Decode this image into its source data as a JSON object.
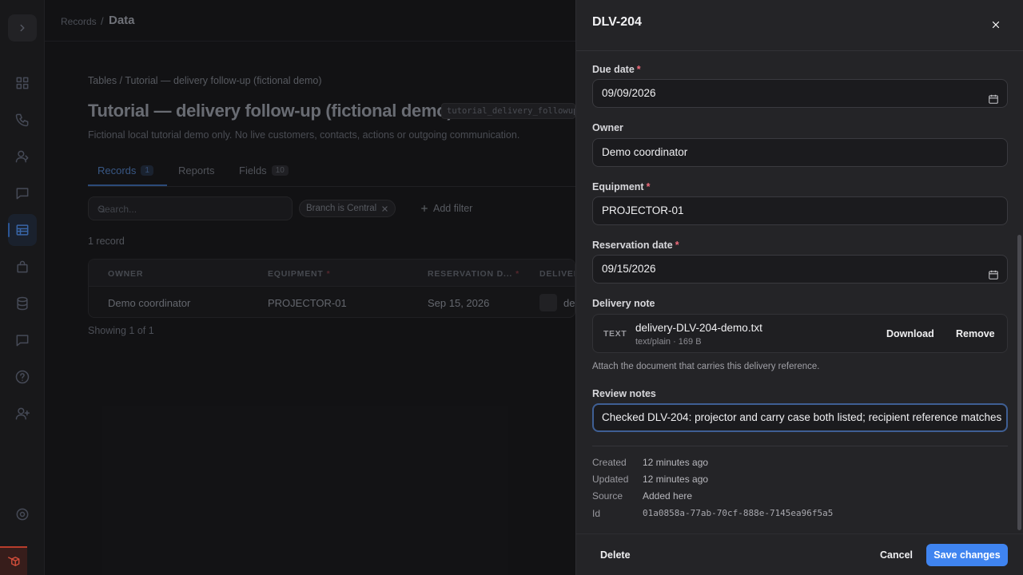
{
  "nav": {
    "icons": [
      "chevron-right-icon",
      "grid-icon",
      "phone-icon",
      "users-icon",
      "chat-icon",
      "table-icon",
      "bag-icon",
      "database-icon",
      "message-icon",
      "help-icon",
      "user-plus-icon",
      "settings-icon"
    ]
  },
  "topbar": {
    "crumb_parent": "Records",
    "crumb_sep": "/",
    "crumb_current": "Data"
  },
  "page": {
    "tables_crumb": "Tables  /  Tutorial — delivery follow-up (fictional demo)",
    "title": "Tutorial — delivery follow-up (fictional demo)",
    "slug": "tutorial_delivery_followup_",
    "description": "Fictional local tutorial demo only. No live customers, contacts, actions or outgoing communication.",
    "tabs": [
      {
        "label": "Records",
        "count": "1"
      },
      {
        "label": "Reports"
      },
      {
        "label": "Fields",
        "count": "10"
      }
    ],
    "search_placeholder": "Search...",
    "filter_chip": "Branch is Central",
    "add_filter": "Add filter",
    "record_count": "1 record",
    "table": {
      "columns": [
        "OWNER",
        "EQUIPMENT",
        "RESERVATION D...",
        "DELIVER"
      ],
      "required_marks": [
        "",
        "*",
        "*",
        ""
      ],
      "row": [
        "Demo coordinator",
        "PROJECTOR-01",
        "Sep 15, 2026",
        "de"
      ]
    },
    "showing": "Showing 1 of 1"
  },
  "drawer": {
    "title": "DLV-204",
    "req_mark": "*",
    "fields": {
      "due_date": {
        "label": "Due date",
        "value": "09/09/2026"
      },
      "owner": {
        "label": "Owner",
        "value": "Demo coordinator"
      },
      "equipment": {
        "label": "Equipment",
        "value": "PROJECTOR-01"
      },
      "reservation_date": {
        "label": "Reservation date",
        "value": "09/15/2026"
      },
      "delivery_note": {
        "label": "Delivery note",
        "file_type": "TEXT",
        "file_name": "delivery-DLV-204-demo.txt",
        "file_meta": "text/plain · 169 B",
        "download": "Download",
        "remove": "Remove",
        "help": "Attach the document that carries this delivery reference."
      },
      "review_notes": {
        "label": "Review notes",
        "value": "Checked DLV-204: projector and carry case both listed; recipient reference matches"
      }
    },
    "meta": {
      "created_label": "Created",
      "created": "12 minutes ago",
      "updated_label": "Updated",
      "updated": "12 minutes ago",
      "source_label": "Source",
      "source": "Added here",
      "id_label": "Id",
      "id": "01a0858a-77ab-70cf-888e-7145ea96f5a5"
    },
    "footer": {
      "delete": "Delete",
      "cancel": "Cancel",
      "save": "Save changes"
    }
  },
  "colors": {
    "accent": "#3f84f0",
    "required": "#ef6b7b",
    "drawer_bg": "#242427",
    "app_bg": "#141416"
  }
}
